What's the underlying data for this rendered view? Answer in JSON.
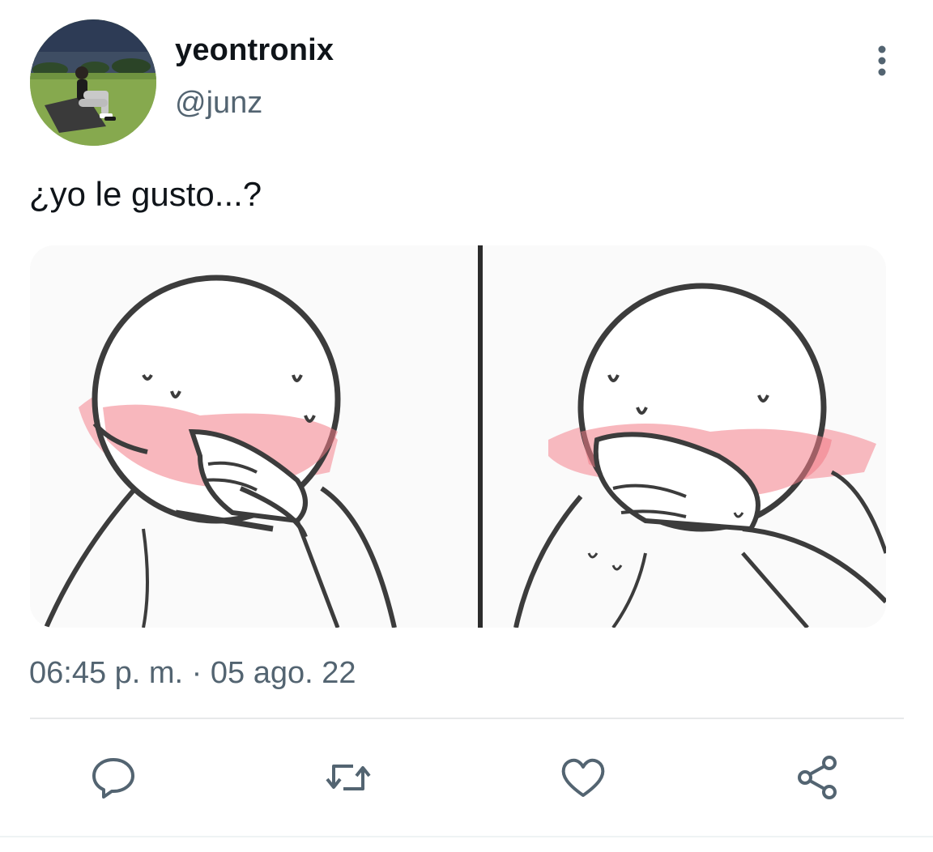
{
  "author": {
    "display_name": "yeontronix",
    "handle": "@junz",
    "avatar_icon": "user-avatar-photo"
  },
  "tweet": {
    "text": "¿yo le gusto...?",
    "timestamp": "06:45 p. m. · 05 ago. 22"
  },
  "actions": {
    "reply_icon": "reply-icon",
    "retweet_icon": "retweet-icon",
    "like_icon": "heart-icon",
    "share_icon": "share-icon",
    "more_icon": "more-vertical-icon"
  },
  "colors": {
    "text_primary": "#0f1419",
    "text_secondary": "#536471",
    "divider": "#e7e9ea",
    "blush": "#f26b7a"
  }
}
